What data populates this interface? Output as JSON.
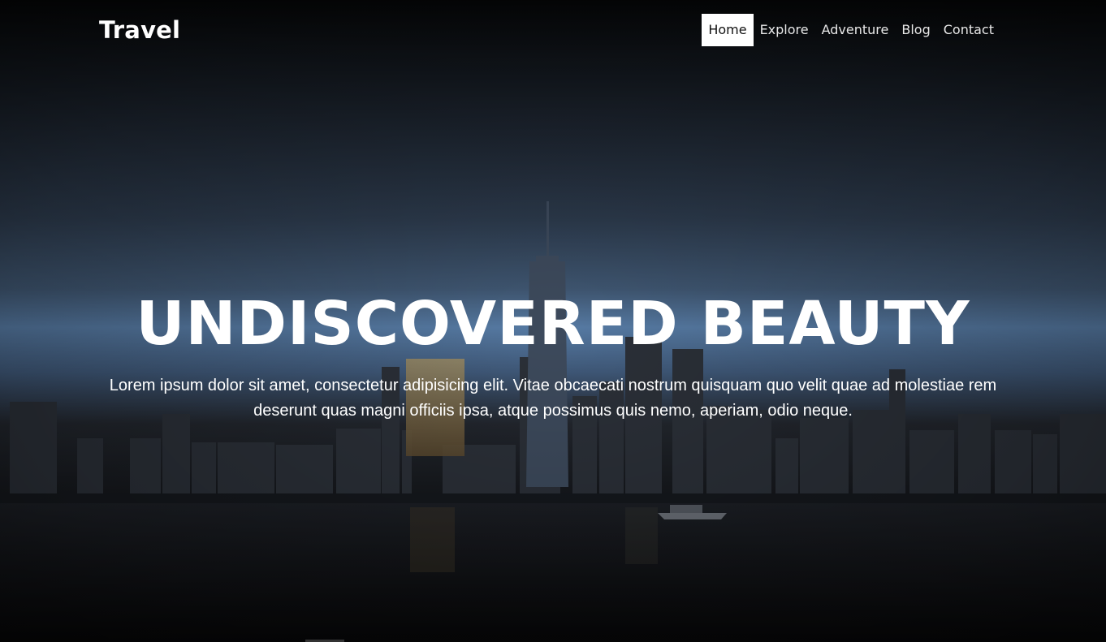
{
  "brand": {
    "name": "Travel"
  },
  "nav": {
    "items": [
      {
        "label": "Home",
        "active": true
      },
      {
        "label": "Explore",
        "active": false
      },
      {
        "label": "Adventure",
        "active": false
      },
      {
        "label": "Blog",
        "active": false
      },
      {
        "label": "Contact",
        "active": false
      }
    ]
  },
  "hero": {
    "headline": "UNDISCOVERED BEAUTY",
    "text": "Lorem ipsum dolor sit amet, consectetur adipisicing elit. Vitae obcaecati nostrum quisquam quo velit quae ad molestiae rem deserunt quas magni officiis ipsa, atque possimus quis nemo, aperiam, odio neque."
  },
  "colors": {
    "nav_text": "#e8e8e8",
    "active_bg": "#ffffff",
    "headline": "#ffffff"
  }
}
